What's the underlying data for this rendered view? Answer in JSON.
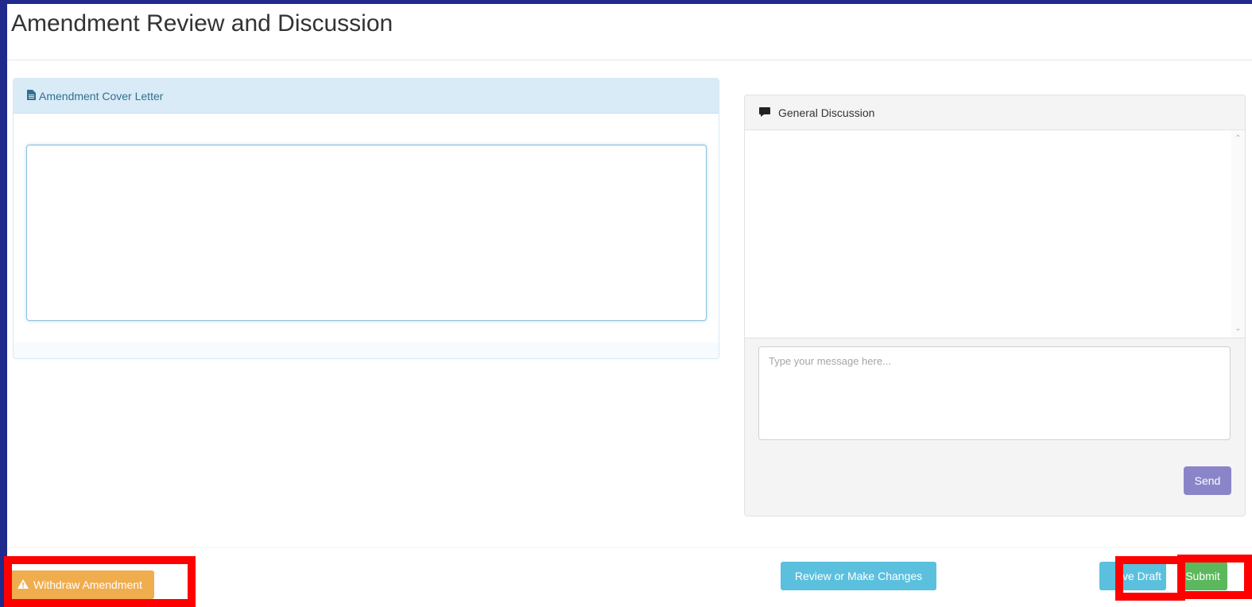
{
  "page": {
    "title": "Amendment Review and Discussion"
  },
  "cover_letter": {
    "heading": "Amendment Cover Letter",
    "icon": "file-text-icon",
    "value": ""
  },
  "discussion": {
    "heading": "General Discussion",
    "icon": "comment-icon",
    "message_placeholder": "Type your message here...",
    "send_label": "Send"
  },
  "footer": {
    "withdraw_label": "Withdraw Amendment",
    "withdraw_icon": "warning-icon",
    "review_label": "Review or Make Changes",
    "save_draft_label": "ave Draft",
    "submit_label": "Submit"
  },
  "colors": {
    "frame": "#1f2a8c",
    "warning": "#f0ad4e",
    "info": "#5bc0de",
    "success": "#5cb85c",
    "send": "#8a85c8",
    "highlight": "#ff0000"
  }
}
